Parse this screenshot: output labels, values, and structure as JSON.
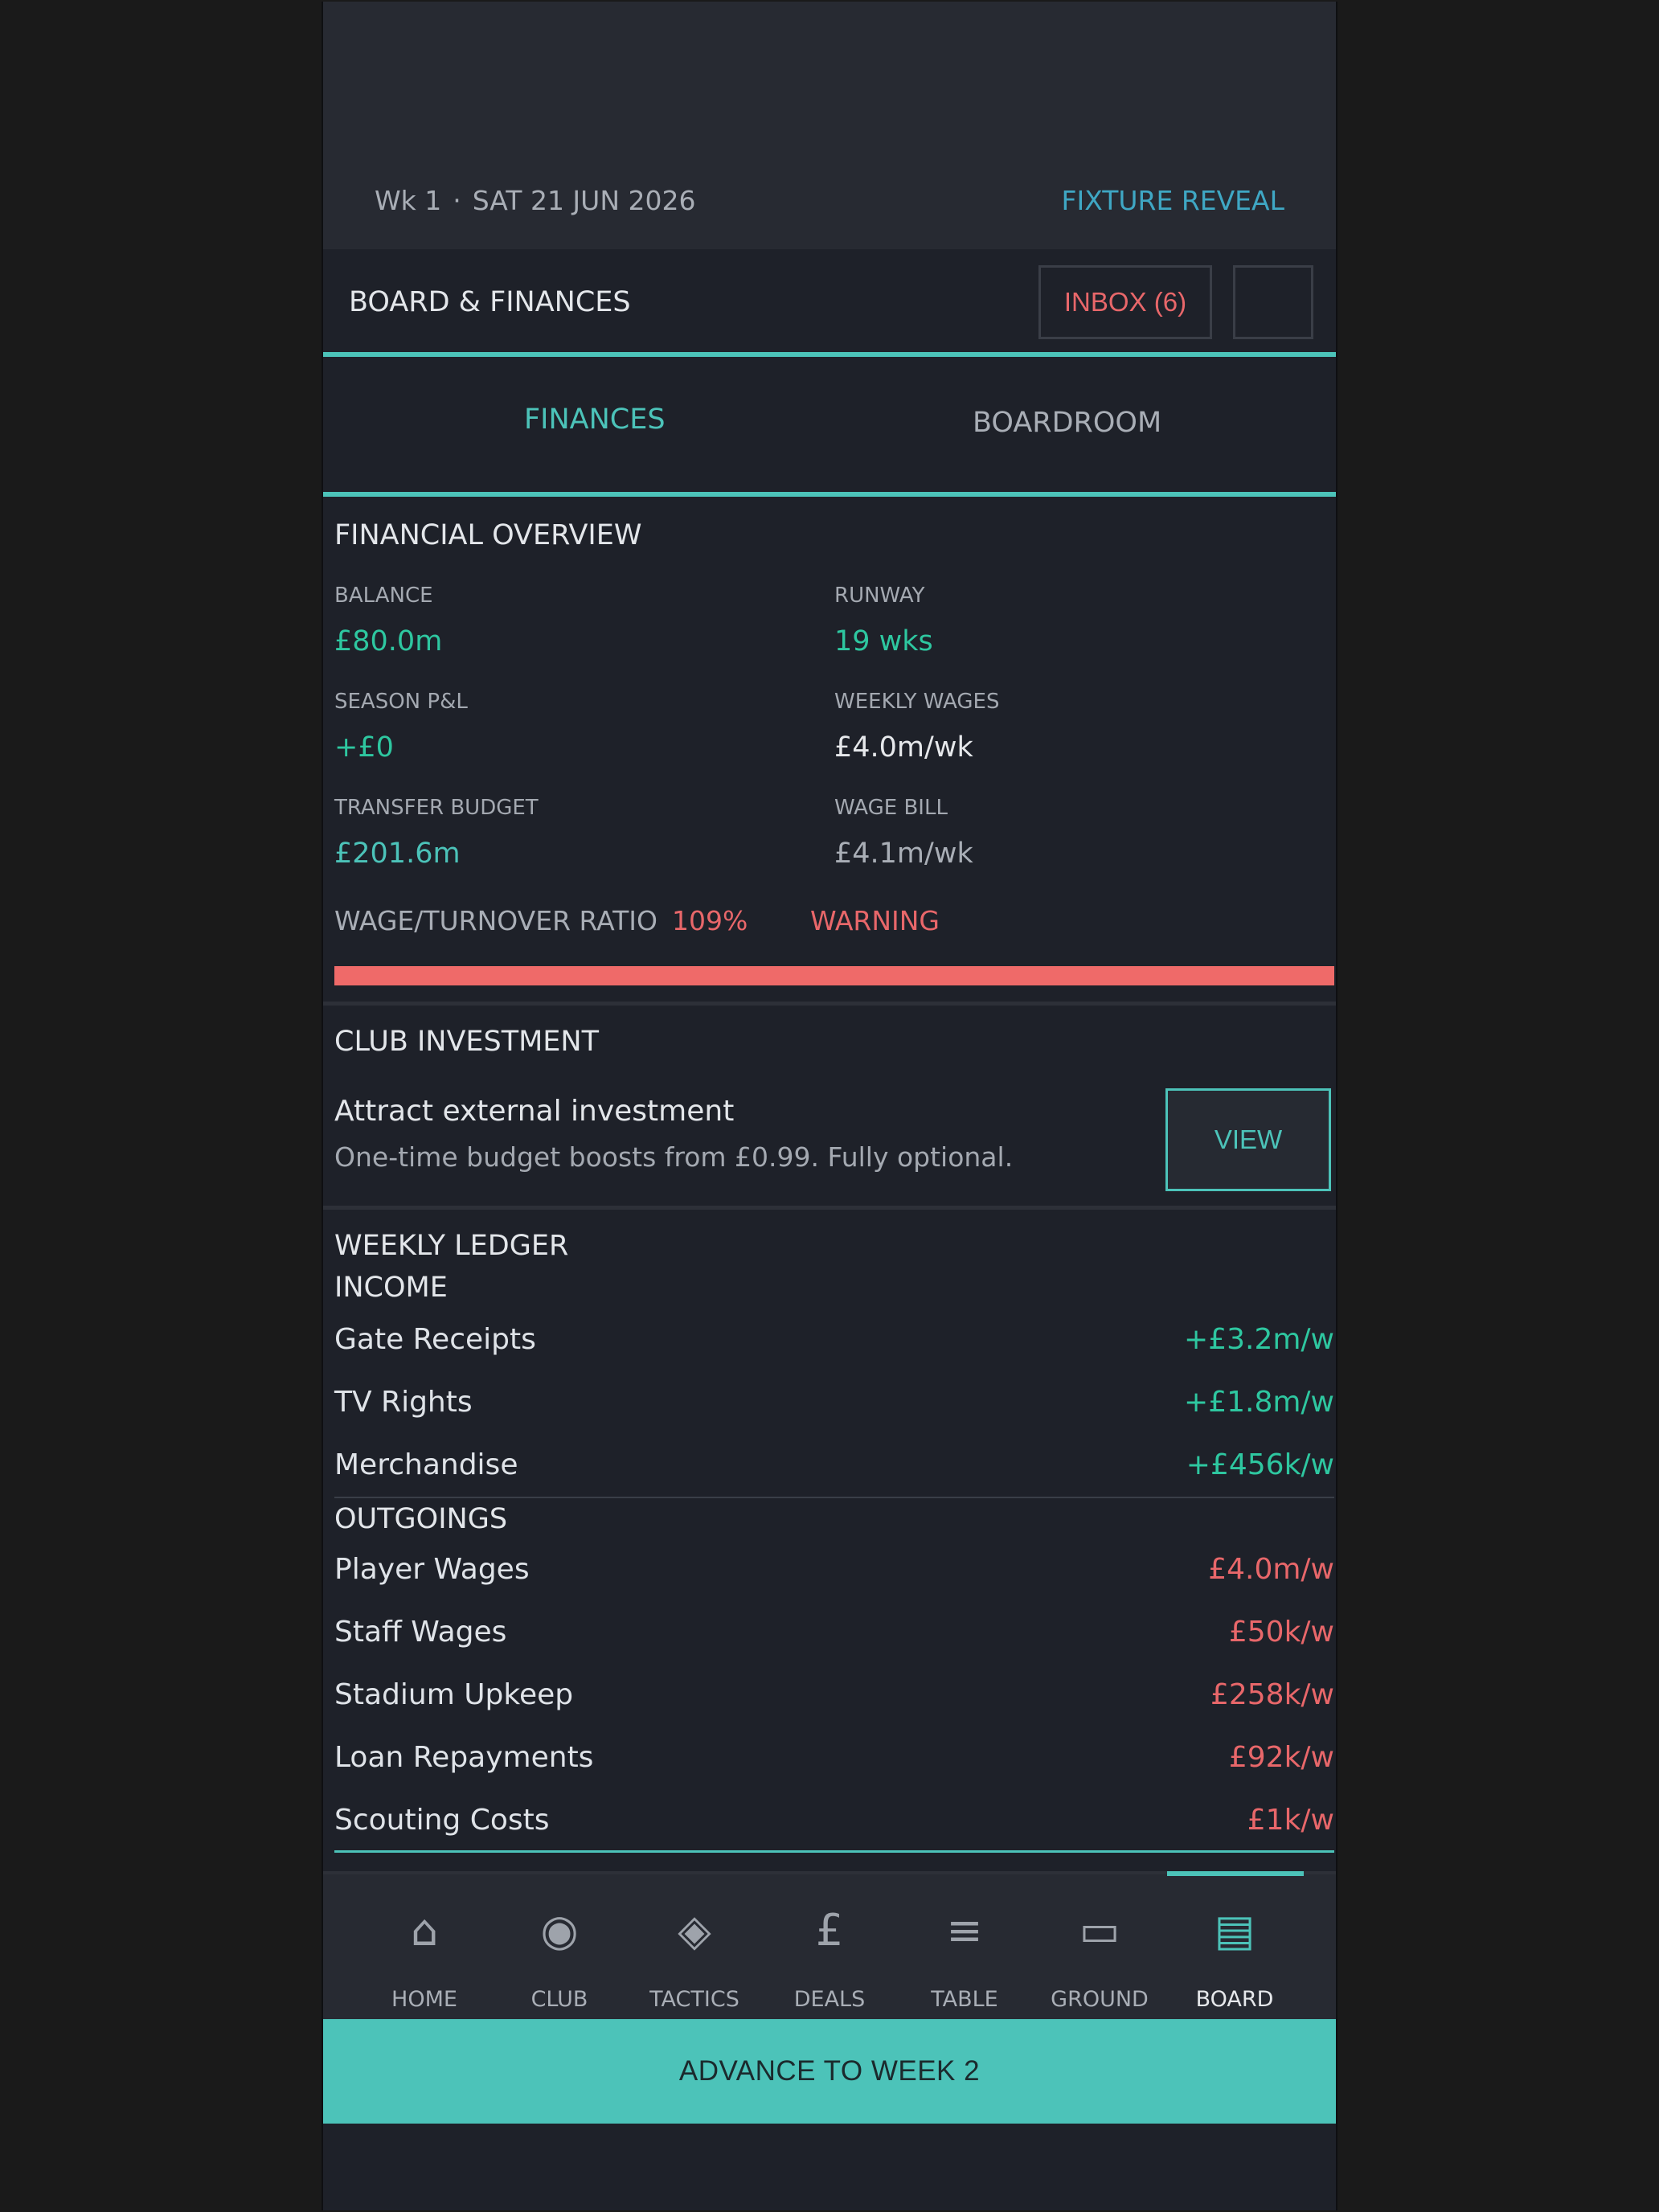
{
  "status": {
    "week": "Wk 1",
    "separator": "·",
    "date": "SAT 21 JUN 2026",
    "fixture_link": "FIXTURE REVEAL"
  },
  "header": {
    "title": "BOARD & FINANCES",
    "inbox_label": "INBOX (6)"
  },
  "tabs": [
    {
      "label": "FINANCES",
      "active": true
    },
    {
      "label": "BOARDROOM",
      "active": false
    }
  ],
  "overview": {
    "title": "FINANCIAL OVERVIEW",
    "balance": {
      "label": "BALANCE",
      "value": "£80.0m"
    },
    "runway": {
      "label": "RUNWAY",
      "value": "19 wks"
    },
    "season_pl": {
      "label": "SEASON P&L",
      "value": "+£0"
    },
    "weekly_wages": {
      "label": "WEEKLY WAGES",
      "value": "£4.0m/wk"
    },
    "transfer_budget": {
      "label": "TRANSFER BUDGET",
      "value": "£201.6m"
    },
    "wage_bill": {
      "label": "WAGE BILL",
      "value": "£4.1m/wk"
    },
    "ratio": {
      "label": "WAGE/TURNOVER RATIO",
      "value": "109%",
      "status": "WARNING",
      "fill_percent": 100
    }
  },
  "investment": {
    "title": "CLUB INVESTMENT",
    "headline": "Attract external investment",
    "subtitle": "One-time budget boosts from £0.99. Fully optional.",
    "view_label": "VIEW"
  },
  "ledger": {
    "title": "WEEKLY LEDGER",
    "income_title": "INCOME",
    "income": [
      {
        "name": "Gate Receipts",
        "amount": "+£3.2m/w"
      },
      {
        "name": "TV Rights",
        "amount": "+£1.8m/w"
      },
      {
        "name": "Merchandise",
        "amount": "+£456k/w"
      }
    ],
    "outgoings_title": "OUTGOINGS",
    "outgoings": [
      {
        "name": "Player Wages",
        "amount": "£4.0m/w"
      },
      {
        "name": "Staff Wages",
        "amount": "£50k/w"
      },
      {
        "name": "Stadium Upkeep",
        "amount": "£258k/w"
      },
      {
        "name": "Loan Repayments",
        "amount": "£92k/w"
      },
      {
        "name": "Scouting Costs",
        "amount": "£1k/w"
      }
    ]
  },
  "nav": [
    {
      "label": "HOME",
      "icon": "home-icon",
      "glyph": "⌂"
    },
    {
      "label": "CLUB",
      "icon": "club-icon",
      "glyph": "◉"
    },
    {
      "label": "TACTICS",
      "icon": "tactics-icon",
      "glyph": "◈"
    },
    {
      "label": "DEALS",
      "icon": "deals-icon",
      "glyph": "£"
    },
    {
      "label": "TABLE",
      "icon": "table-icon",
      "glyph": "≡"
    },
    {
      "label": "GROUND",
      "icon": "ground-icon",
      "glyph": "▭"
    },
    {
      "label": "BOARD",
      "icon": "board-icon",
      "glyph": "▤",
      "active": true
    }
  ],
  "advance_label": "ADVANCE TO WEEK 2",
  "colors": {
    "accent": "#4cc3b9",
    "positive": "#2ec7a0",
    "negative": "#e8676a",
    "link": "#3fa7c4",
    "background": "#1e2129"
  }
}
